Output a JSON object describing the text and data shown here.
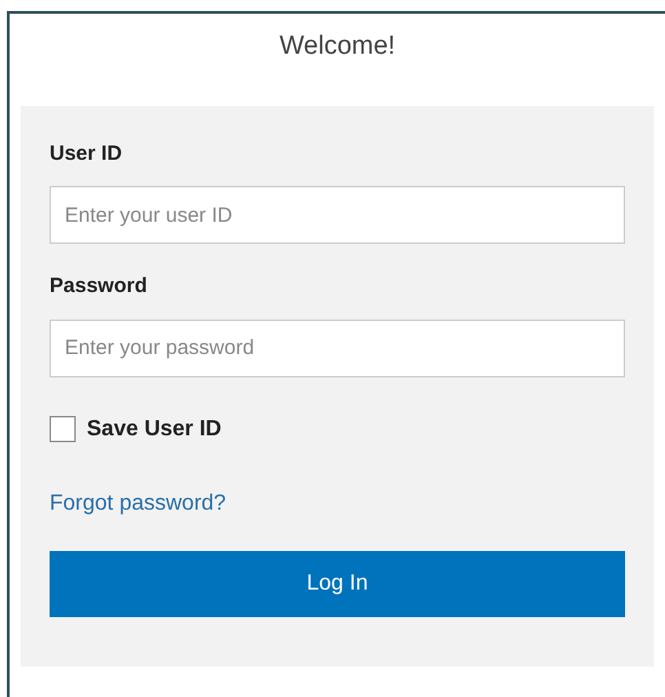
{
  "title": "Welcome!",
  "fields": [
    {
      "label": "User ID",
      "placeholder": "Enter your user ID"
    },
    {
      "label": "Password",
      "placeholder": "Enter your password"
    }
  ],
  "save_user_id": {
    "label": "Save User ID",
    "checked": false
  },
  "forgot_link": "Forgot password?",
  "login_button": "Log In"
}
